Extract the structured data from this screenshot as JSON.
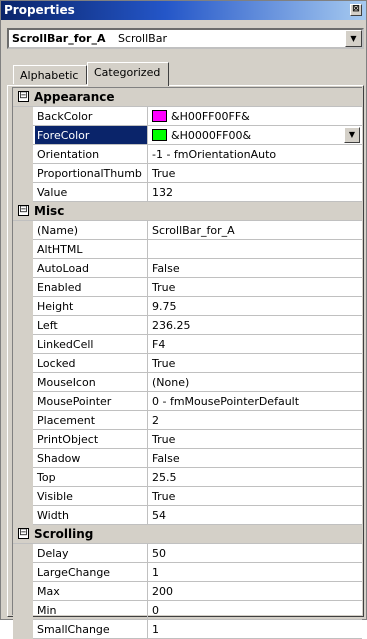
{
  "window": {
    "title": "Properties",
    "close_glyph": "⊠"
  },
  "object_selector": {
    "name": "ScrollBar_for_A",
    "type": "ScrollBar",
    "arrow": "▼"
  },
  "tabs": [
    {
      "label": "Alphabetic",
      "active": false
    },
    {
      "label": "Categorized",
      "active": true
    }
  ],
  "categories": [
    {
      "toggle": "⊟",
      "name": "Appearance",
      "properties": [
        {
          "name": "BackColor",
          "value": "&H00FF00FF&",
          "swatch": "#ff00ff"
        },
        {
          "name": "ForeColor",
          "value": "&H0000FF00&",
          "swatch": "#00ff00",
          "selected": true
        },
        {
          "name": "Orientation",
          "value": "-1 - fmOrientationAuto"
        },
        {
          "name": "ProportionalThumb",
          "value": "True"
        },
        {
          "name": "Value",
          "value": "132"
        }
      ]
    },
    {
      "toggle": "⊟",
      "name": "Misc",
      "properties": [
        {
          "name": "(Name)",
          "value": "ScrollBar_for_A"
        },
        {
          "name": "AltHTML",
          "value": ""
        },
        {
          "name": "AutoLoad",
          "value": "False"
        },
        {
          "name": "Enabled",
          "value": "True"
        },
        {
          "name": "Height",
          "value": "9.75"
        },
        {
          "name": "Left",
          "value": "236.25"
        },
        {
          "name": "LinkedCell",
          "value": "F4"
        },
        {
          "name": "Locked",
          "value": "True"
        },
        {
          "name": "MouseIcon",
          "value": "(None)"
        },
        {
          "name": "MousePointer",
          "value": "0 - fmMousePointerDefault"
        },
        {
          "name": "Placement",
          "value": "2"
        },
        {
          "name": "PrintObject",
          "value": "True"
        },
        {
          "name": "Shadow",
          "value": "False"
        },
        {
          "name": "Top",
          "value": "25.5"
        },
        {
          "name": "Visible",
          "value": "True"
        },
        {
          "name": "Width",
          "value": "54"
        }
      ]
    },
    {
      "toggle": "⊟",
      "name": "Scrolling",
      "properties": [
        {
          "name": "Delay",
          "value": "50"
        },
        {
          "name": "LargeChange",
          "value": "1"
        },
        {
          "name": "Max",
          "value": "200"
        },
        {
          "name": "Min",
          "value": "0"
        },
        {
          "name": "SmallChange",
          "value": "1"
        }
      ]
    }
  ],
  "colors": {
    "title_start": "#0a246a",
    "title_end": "#a6caf0",
    "selection": "#0a246a",
    "face": "#d4d0c8"
  }
}
